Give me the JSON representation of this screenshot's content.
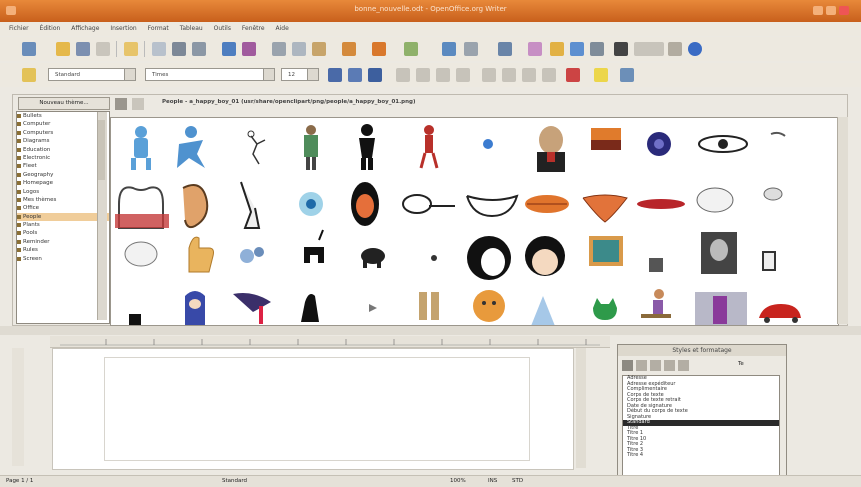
{
  "window": {
    "title": "bonne_nouvelle.odt - OpenOffice.org Writer"
  },
  "menu": [
    "Fichier",
    "Édition",
    "Affichage",
    "Insertion",
    "Format",
    "Tableau",
    "Outils",
    "Fenêtre",
    "Aide"
  ],
  "formatting": {
    "style": "Standard",
    "font": "Times",
    "size": "12"
  },
  "gallery": {
    "new_theme_button": "Nouveau thème...",
    "path": "People - a_happy_boy_01 (usr/share/openclipart/png/people/a_happy_boy_01.png)",
    "themes": [
      "Bullets",
      "Computer",
      "Computers",
      "Diagrams",
      "Education",
      "Electronic",
      "Fleet",
      "Geography",
      "Homepage",
      "Logos",
      "Mes thèmes",
      "Office",
      "People",
      "Plants",
      "Pools",
      "Reminder",
      "Rules",
      "Screen"
    ],
    "selected_theme": "People"
  },
  "styles_panel": {
    "title": "Styles et formatage",
    "filter_label": "Te",
    "items": [
      "Adresse",
      "Adresse expéditeur",
      "Complimentaire",
      "Corps de texte",
      "Corps de texte retrait",
      "Date de signature",
      "Début du corps de texte",
      "Signature",
      "Standard",
      "Titre",
      "Titre 1",
      "Titre 10",
      "Titre 2",
      "Titre 3",
      "Titre 4"
    ],
    "selected": "Standard"
  },
  "status": {
    "page": "Page 1 / 1",
    "style": "Standard",
    "zoom": "100%",
    "mode": "INS",
    "std": "STD"
  },
  "colors": {
    "titlebar": "#d8702c",
    "selected_theme": "#f0cd9a"
  }
}
